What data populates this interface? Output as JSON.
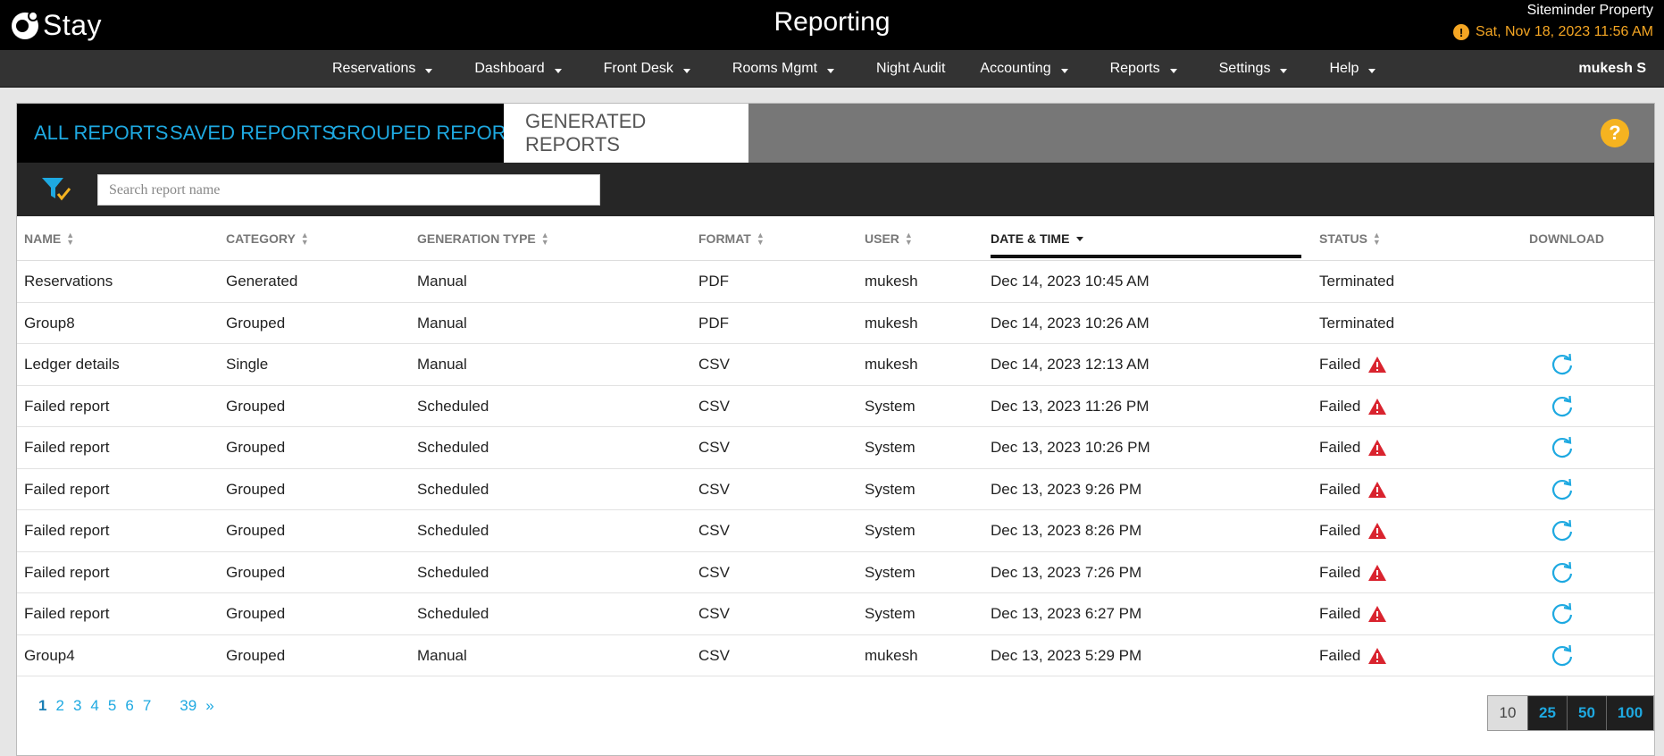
{
  "header": {
    "logo_text": "Stay",
    "app_title": "Reporting",
    "property": "Siteminder Property",
    "datetime": "Sat, Nov 18, 2023 11:56 AM",
    "warn_glyph": "!"
  },
  "nav": {
    "items": [
      {
        "label": "Reservations",
        "has_menu": true
      },
      {
        "label": "Dashboard",
        "has_menu": true
      },
      {
        "label": "Front Desk",
        "has_menu": true
      },
      {
        "label": "Rooms Mgmt",
        "has_menu": true
      },
      {
        "label": "Night Audit",
        "has_menu": false
      },
      {
        "label": "Accounting",
        "has_menu": true
      },
      {
        "label": "Reports",
        "has_menu": true
      },
      {
        "label": "Settings",
        "has_menu": true
      },
      {
        "label": "Help",
        "has_menu": true
      }
    ],
    "user": "mukesh S"
  },
  "tabs": {
    "all": "ALL REPORTS",
    "saved": "SAVED REPORTS",
    "grouped": "GROUPED REPORTS",
    "generated": "GENERATED REPORTS",
    "help": "?"
  },
  "search": {
    "placeholder": "Search report name",
    "value": ""
  },
  "columns": {
    "name": "NAME",
    "category": "CATEGORY",
    "generation_type": "GENERATION TYPE",
    "format": "FORMAT",
    "user": "USER",
    "datetime": "DATE & TIME",
    "status": "STATUS",
    "download": "DOWNLOAD"
  },
  "rows": [
    {
      "name": "Reservations",
      "category": "Generated",
      "type": "Manual",
      "format": "PDF",
      "user": "mukesh",
      "datetime": "Dec 14, 2023 10:45 AM",
      "status": "Terminated",
      "failed": false
    },
    {
      "name": "Group8",
      "category": "Grouped",
      "type": "Manual",
      "format": "PDF",
      "user": "mukesh",
      "datetime": "Dec 14, 2023 10:26 AM",
      "status": "Terminated",
      "failed": false
    },
    {
      "name": "Ledger details",
      "category": "Single",
      "type": "Manual",
      "format": "CSV",
      "user": "mukesh",
      "datetime": "Dec 14, 2023 12:13 AM",
      "status": "Failed",
      "failed": true
    },
    {
      "name": "Failed report",
      "category": "Grouped",
      "type": "Scheduled",
      "format": "CSV",
      "user": "System",
      "datetime": "Dec 13, 2023 11:26 PM",
      "status": "Failed",
      "failed": true
    },
    {
      "name": "Failed report",
      "category": "Grouped",
      "type": "Scheduled",
      "format": "CSV",
      "user": "System",
      "datetime": "Dec 13, 2023 10:26 PM",
      "status": "Failed",
      "failed": true
    },
    {
      "name": "Failed report",
      "category": "Grouped",
      "type": "Scheduled",
      "format": "CSV",
      "user": "System",
      "datetime": "Dec 13, 2023 9:26 PM",
      "status": "Failed",
      "failed": true
    },
    {
      "name": "Failed report",
      "category": "Grouped",
      "type": "Scheduled",
      "format": "CSV",
      "user": "System",
      "datetime": "Dec 13, 2023 8:26 PM",
      "status": "Failed",
      "failed": true
    },
    {
      "name": "Failed report",
      "category": "Grouped",
      "type": "Scheduled",
      "format": "CSV",
      "user": "System",
      "datetime": "Dec 13, 2023 7:26 PM",
      "status": "Failed",
      "failed": true
    },
    {
      "name": "Failed report",
      "category": "Grouped",
      "type": "Scheduled",
      "format": "CSV",
      "user": "System",
      "datetime": "Dec 13, 2023 6:27 PM",
      "status": "Failed",
      "failed": true
    },
    {
      "name": "Group4",
      "category": "Grouped",
      "type": "Manual",
      "format": "CSV",
      "user": "mukesh",
      "datetime": "Dec 13, 2023 5:29 PM",
      "status": "Failed",
      "failed": true
    }
  ],
  "pagination": {
    "pages": [
      "1",
      "2",
      "3",
      "4",
      "5",
      "6",
      "7"
    ],
    "current": "1",
    "last": "39",
    "next": "»",
    "page_sizes": [
      "10",
      "25",
      "50",
      "100"
    ],
    "selected_size": "10"
  },
  "colors": {
    "accent": "#1ea9e1",
    "warning": "#f5a623",
    "error": "#d9232e"
  },
  "icons": {
    "filter": "filter-icon",
    "refresh": "refresh-icon",
    "alert": "warning-triangle-icon"
  }
}
